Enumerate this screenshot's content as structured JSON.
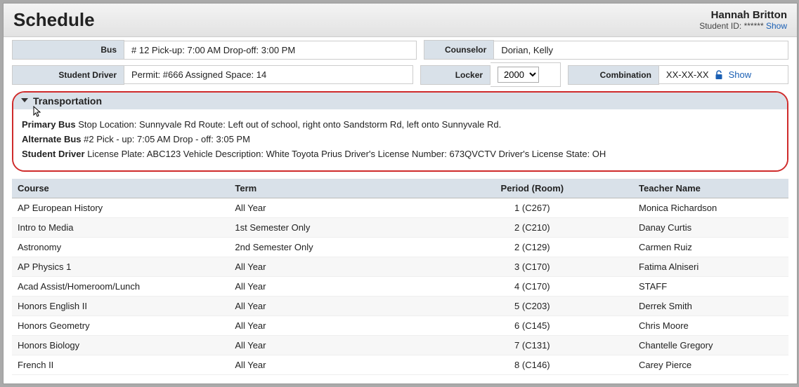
{
  "header": {
    "title": "Schedule",
    "student_name": "Hannah Britton",
    "student_id_label": "Student ID:",
    "student_id_masked": "******",
    "show_label": "Show"
  },
  "fields": {
    "bus_label": "Bus",
    "bus_value": "# 12   Pick-up: 7:00 AM   Drop-off: 3:00 PM",
    "counselor_label": "Counselor",
    "counselor_value": "Dorian, Kelly",
    "driver_label": "Student Driver",
    "driver_value": "Permit: #666   Assigned Space: 14",
    "locker_label": "Locker",
    "locker_value": "2000",
    "combo_label": "Combination",
    "combo_value": "XX-XX-XX",
    "combo_show": "Show"
  },
  "transport": {
    "title": "Transportation",
    "primary_label": "Primary Bus",
    "primary_text": "Stop Location: Sunnyvale Rd Route: Left out of school, right onto Sandstorm Rd, left onto Sunnyvale Rd.",
    "alt_label": "Alternate Bus",
    "alt_text": "#2 Pick - up: 7:05 AM Drop - off: 3:05 PM",
    "driver_label": "Student Driver",
    "driver_text": "License Plate: ABC123 Vehicle Description: White Toyota Prius Driver's License Number: 673QVCTV Driver's License State: OH"
  },
  "columns": {
    "course": "Course",
    "term": "Term",
    "period": "Period (Room)",
    "teacher": "Teacher Name"
  },
  "rows": [
    {
      "course": "AP European History",
      "term": "All Year",
      "period": "1 (C267)",
      "teacher": "Monica Richardson"
    },
    {
      "course": "Intro to Media",
      "term": "1st Semester Only",
      "period": "2 (C210)",
      "teacher": "Danay Curtis"
    },
    {
      "course": "Astronomy",
      "term": "2nd Semester Only",
      "period": "2 (C129)",
      "teacher": "Carmen Ruiz"
    },
    {
      "course": "AP Physics 1",
      "term": "All Year",
      "period": "3 (C170)",
      "teacher": "Fatima Alniseri"
    },
    {
      "course": "Acad Assist/Homeroom/Lunch",
      "term": "All Year",
      "period": "4 (C170)",
      "teacher": "STAFF"
    },
    {
      "course": "Honors English II",
      "term": "All Year",
      "period": "5 (C203)",
      "teacher": "Derrek Smith"
    },
    {
      "course": "Honors Geometry",
      "term": "All Year",
      "period": "6 (C145)",
      "teacher": "Chris Moore"
    },
    {
      "course": "Honors Biology",
      "term": "All Year",
      "period": "7 (C131)",
      "teacher": "Chantelle Gregory"
    },
    {
      "course": "French II",
      "term": "All Year",
      "period": "8 (C146)",
      "teacher": "Carey Pierce"
    }
  ]
}
